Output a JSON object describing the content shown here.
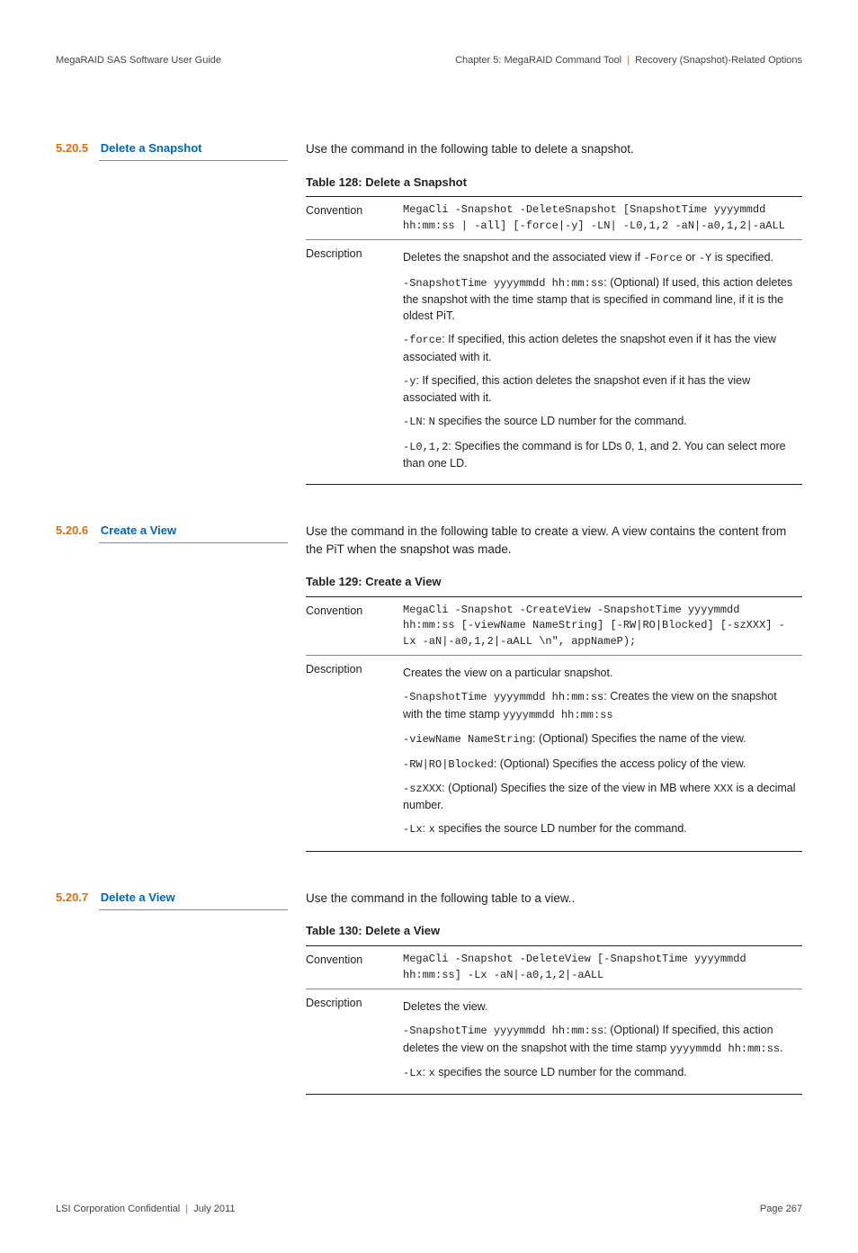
{
  "header": {
    "left": "MegaRAID SAS Software User Guide",
    "right_chapter": "Chapter 5: MegaRAID Command Tool",
    "right_topic": "Recovery (Snapshot)-Related Options"
  },
  "sections": {
    "s1": {
      "num": "5.20.5",
      "title": "Delete a Snapshot",
      "intro": "Use the command in the following table to delete a snapshot.",
      "table_caption": "Table 128: Delete a Snapshot",
      "convention_label": "Convention",
      "convention": "MegaCli -Snapshot -DeleteSnapshot [SnapshotTime yyyymmdd hh:mm:ss | -all] [-force|-y] -LN| -L0,1,2 -aN|-a0,1,2|-aALL",
      "description_label": "Description",
      "desc1_a": "Deletes the snapshot and the associated view if ",
      "desc1_b": "-Force",
      "desc1_c": " or ",
      "desc1_d": "-Y",
      "desc1_e": " is specified.",
      "desc2_a": "-SnapshotTime yyyymmdd hh:mm:ss",
      "desc2_b": ": (Optional) If used, this action deletes the snapshot with the time stamp that is specified in command line, if it is the oldest PiT.",
      "desc3_a": "-force",
      "desc3_b": ": If specified, this action deletes the snapshot even if it has the view associated with it.",
      "desc4_a": "-y",
      "desc4_b": ": If specified, this action deletes the snapshot even if it has the view associated with it.",
      "desc5_a": "-LN",
      "desc5_b": ": ",
      "desc5_c": "N",
      "desc5_d": " specifies the source LD number for the command.",
      "desc6_a": "-L0,1,2",
      "desc6_b": ": Specifies the command is for LDs 0, 1, and 2. You can select more than one LD."
    },
    "s2": {
      "num": "5.20.6",
      "title": "Create a View",
      "intro": "Use the command in the following table to create a view. A view contains the content from the PiT when the snapshot was made.",
      "table_caption": "Table 129: Create a View",
      "convention_label": "Convention",
      "convention": "MegaCli -Snapshot -CreateView -SnapshotTime yyyymmdd hh:mm:ss [-viewName NameString] [-RW|RO|Blocked] [-szXXX] -Lx -aN|-a0,1,2|-aALL \\n\", appNameP);",
      "description_label": "Description",
      "desc1": "Creates the view on a particular snapshot.",
      "desc2_a": "-SnapshotTime yyyymmdd hh:mm:ss",
      "desc2_b": ": Creates the view on the snapshot with the time stamp ",
      "desc2_c": "yyyymmdd hh:mm:ss",
      "desc3_a": "-viewName NameString",
      "desc3_b": ": (Optional) Specifies the name of the view.",
      "desc4_a": "-RW|RO|Blocked",
      "desc4_b": ": (Optional) Specifies the access policy of the view.",
      "desc5_a": "-szXXX",
      "desc5_b": ": (Optional) Specifies the size of the view in MB where ",
      "desc5_c": "XXX",
      "desc5_d": " is a decimal number.",
      "desc6_a": "-Lx",
      "desc6_b": ": ",
      "desc6_c": "x",
      "desc6_d": " specifies the source LD number for the command."
    },
    "s3": {
      "num": "5.20.7",
      "title": "Delete a View",
      "intro": "Use the command in the following table to a view..",
      "table_caption": "Table 130: Delete a View",
      "convention_label": "Convention",
      "convention": "MegaCli -Snapshot -DeleteView [-SnapshotTime yyyymmdd hh:mm:ss] -Lx -aN|-a0,1,2|-aALL",
      "description_label": "Description",
      "desc1": "Deletes the view.",
      "desc2_a": "-SnapshotTime yyyymmdd hh:mm:ss",
      "desc2_b": ": (Optional) If specified, this action deletes the view on the snapshot with the time stamp ",
      "desc2_c": "yyyymmdd hh:mm:ss",
      "desc2_d": ".",
      "desc3_a": "-Lx",
      "desc3_b": ": ",
      "desc3_c": "x",
      "desc3_d": " specifies the source LD number for the command."
    }
  },
  "footer": {
    "left_a": "LSI Corporation Confidential",
    "left_b": "July 2011",
    "right": "Page 267"
  }
}
